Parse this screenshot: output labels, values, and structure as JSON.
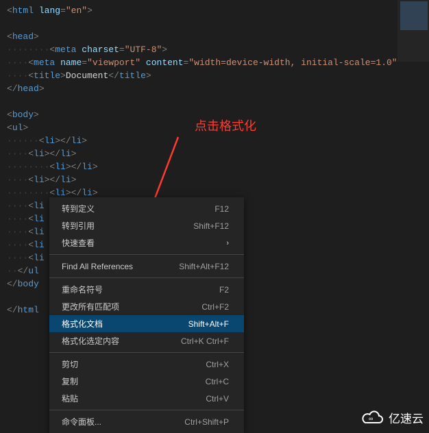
{
  "code": {
    "lines": [
      {
        "html": "<span class='punct'>&lt;</span><span class='tag'>html</span> <span class='attr'>lang</span><span class='punct'>=</span><span class='str'>\"en\"</span><span class='punct'>&gt;</span>"
      },
      {
        "html": ""
      },
      {
        "html": "<span class='punct'>&lt;</span><span class='tag'>head</span><span class='punct'>&gt;</span>"
      },
      {
        "html": "<span class='dots'>········</span><span class='punct'>&lt;</span><span class='tag'>meta</span> <span class='attr'>charset</span><span class='punct'>=</span><span class='str'>\"UTF-8\"</span><span class='punct'>&gt;</span>"
      },
      {
        "html": "<span class='dots'>····</span><span class='punct'>&lt;</span><span class='tag'>meta</span> <span class='attr'>name</span><span class='punct'>=</span><span class='str'>\"viewport\"</span> <span class='attr'>content</span><span class='punct'>=</span><span class='str'>\"width=device-width, initial-scale=1.0\"</span>"
      },
      {
        "html": "<span class='dots'>····</span><span class='punct'>&lt;</span><span class='tag'>title</span><span class='punct'>&gt;</span><span class='txt'>Document</span><span class='punct'>&lt;/</span><span class='tag'>title</span><span class='punct'>&gt;</span>"
      },
      {
        "html": "<span class='punct'>&lt;/</span><span class='tag'>head</span><span class='punct'>&gt;</span>"
      },
      {
        "html": ""
      },
      {
        "html": "<span class='punct'>&lt;</span><span class='tag'>body</span><span class='punct'>&gt;</span>"
      },
      {
        "html": "<span class='punct'>&lt;</span><span class='tag'>ul</span><span class='punct'>&gt;</span>"
      },
      {
        "html": "<span class='dots'>······</span><span class='punct'>&lt;</span><span class='tag'>li</span><span class='punct'>&gt;&lt;/</span><span class='tag'>li</span><span class='punct'>&gt;</span>"
      },
      {
        "html": "<span class='dots'>····</span><span class='punct'>&lt;</span><span class='tag'>li</span><span class='punct'>&gt;&lt;/</span><span class='tag'>li</span><span class='punct'>&gt;</span>"
      },
      {
        "html": "<span class='dots'>········</span><span class='punct'>&lt;</span><span class='tag'>li</span><span class='punct'>&gt;&lt;/</span><span class='tag'>li</span><span class='punct'>&gt;</span>"
      },
      {
        "html": "<span class='dots'>····</span><span class='punct'>&lt;</span><span class='tag'>li</span><span class='punct'>&gt;&lt;/</span><span class='tag'>li</span><span class='punct'>&gt;</span>"
      },
      {
        "html": "<span class='dots'>········</span><span class='punct'>&lt;</span><span class='tag'>li</span><span class='punct'>&gt;&lt;/</span><span class='tag'>li</span><span class='punct'>&gt;</span>"
      },
      {
        "html": "<span class='dots'>····</span><span class='punct'>&lt;</span><span class='tag'>li</span>"
      },
      {
        "html": "<span class='dots'>····</span><span class='punct'>&lt;</span><span class='tag'>li</span>"
      },
      {
        "html": "<span class='dots'>····</span><span class='punct'>&lt;</span><span class='tag'>li</span>"
      },
      {
        "html": "<span class='dots'>····</span><span class='punct'>&lt;</span><span class='tag'>li</span>"
      },
      {
        "html": "<span class='dots'>····</span><span class='punct'>&lt;</span><span class='tag'>li</span>"
      },
      {
        "html": "<span class='dots'>··</span><span class='punct'>&lt;/</span><span class='tag'>ul</span>"
      },
      {
        "html": "<span class='punct'>&lt;/</span><span class='tag'>body</span>"
      },
      {
        "html": ""
      },
      {
        "html": "<span class='punct'>&lt;/</span><span class='tag'>html</span>"
      }
    ]
  },
  "annotation": {
    "text": "点击格式化"
  },
  "context_menu": {
    "items": [
      {
        "label": "转到定义",
        "shortcut": "F12",
        "sep": false,
        "hl": false,
        "arrow": false
      },
      {
        "label": "转到引用",
        "shortcut": "Shift+F12",
        "sep": false,
        "hl": false,
        "arrow": false
      },
      {
        "label": "快速查看",
        "shortcut": "",
        "sep": false,
        "hl": false,
        "arrow": true
      },
      {
        "sep": true
      },
      {
        "label": "Find All References",
        "shortcut": "Shift+Alt+F12",
        "sep": false,
        "hl": false,
        "arrow": false
      },
      {
        "sep": true
      },
      {
        "label": "重命名符号",
        "shortcut": "F2",
        "sep": false,
        "hl": false,
        "arrow": false
      },
      {
        "label": "更改所有匹配项",
        "shortcut": "Ctrl+F2",
        "sep": false,
        "hl": false,
        "arrow": false
      },
      {
        "label": "格式化文档",
        "shortcut": "Shift+Alt+F",
        "sep": false,
        "hl": true,
        "arrow": false
      },
      {
        "label": "格式化选定内容",
        "shortcut": "Ctrl+K Ctrl+F",
        "sep": false,
        "hl": false,
        "arrow": false
      },
      {
        "sep": true
      },
      {
        "label": "剪切",
        "shortcut": "Ctrl+X",
        "sep": false,
        "hl": false,
        "arrow": false
      },
      {
        "label": "复制",
        "shortcut": "Ctrl+C",
        "sep": false,
        "hl": false,
        "arrow": false
      },
      {
        "label": "粘贴",
        "shortcut": "Ctrl+V",
        "sep": false,
        "hl": false,
        "arrow": false
      },
      {
        "sep": true
      },
      {
        "label": "命令面板...",
        "shortcut": "Ctrl+Shift+P",
        "sep": false,
        "hl": false,
        "arrow": false
      }
    ]
  },
  "watermark": {
    "text": "亿速云"
  }
}
